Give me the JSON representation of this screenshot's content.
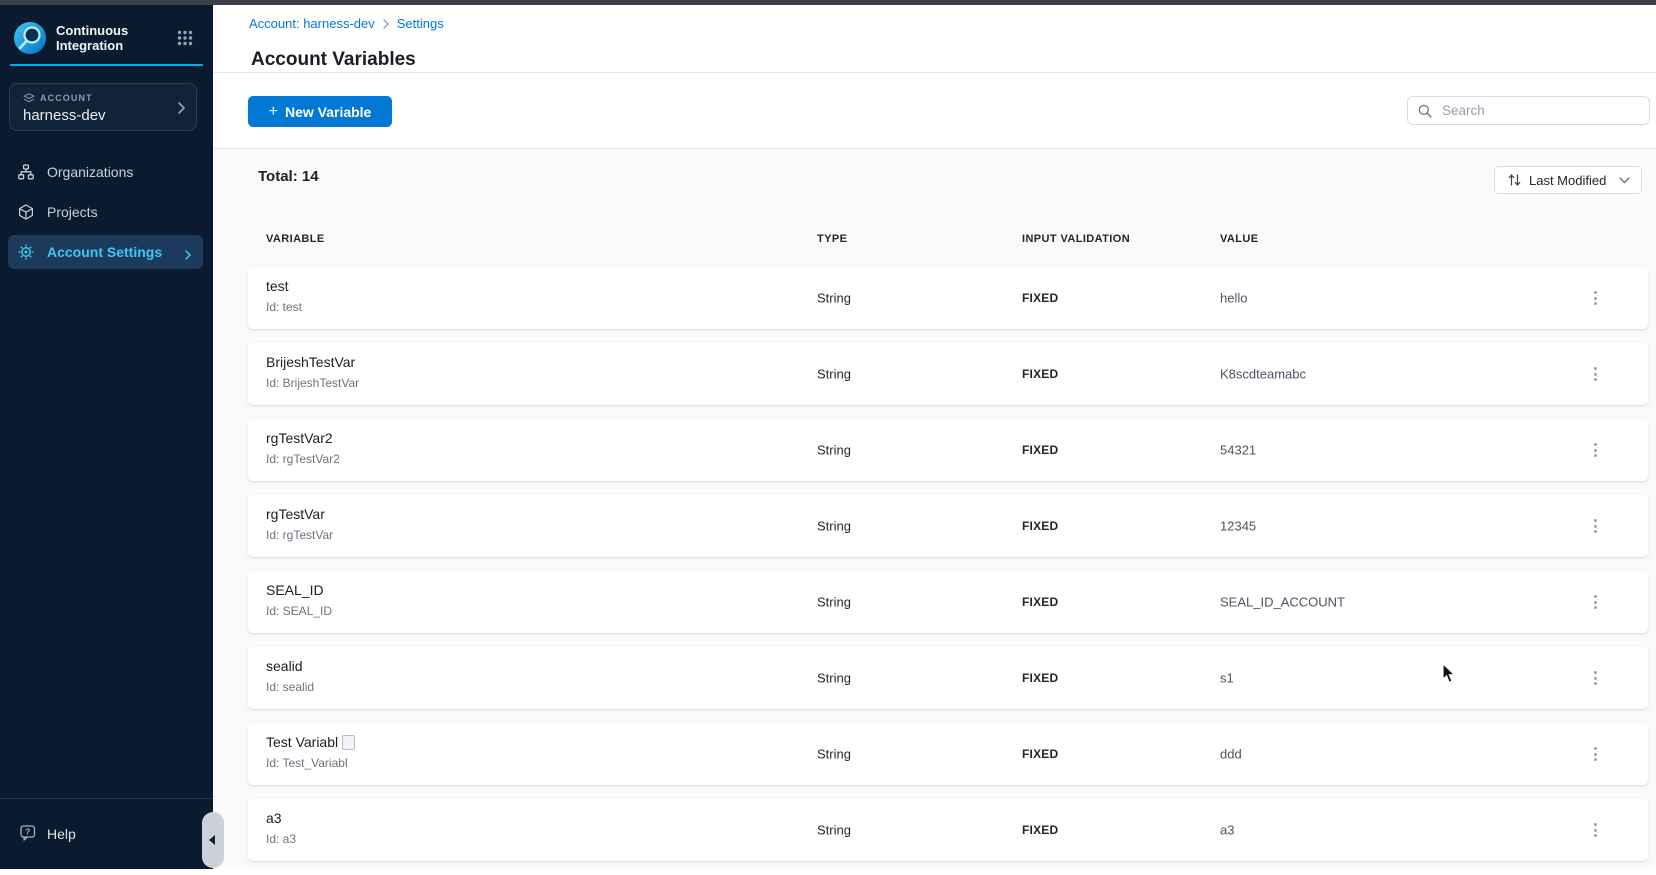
{
  "sidebar": {
    "module_line1": "Continuous",
    "module_line2": "Integration",
    "account": {
      "label": "ACCOUNT",
      "name": "harness-dev"
    },
    "nav": [
      {
        "label": "Organizations",
        "icon": "org-chart-icon",
        "selected": false
      },
      {
        "label": "Projects",
        "icon": "cube-icon",
        "selected": false
      },
      {
        "label": "Account Settings",
        "icon": "gear-icon",
        "selected": true
      }
    ],
    "help_label": "Help"
  },
  "breadcrumb": {
    "account_link": "Account: harness-dev",
    "separator": "›",
    "current": "Settings"
  },
  "page": {
    "title": "Account Variables"
  },
  "toolbar": {
    "new_variable_label": "New Variable",
    "plus_glyph": "+",
    "search_placeholder": "Search"
  },
  "list": {
    "total_label": "Total: 14",
    "sort_label": "Last Modified",
    "columns": {
      "variable": "VARIABLE",
      "type": "TYPE",
      "validation": "INPUT VALIDATION",
      "value": "VALUE"
    },
    "rows": [
      {
        "name": "test",
        "id": "Id: test",
        "type": "String",
        "validation": "FIXED",
        "value": "hello"
      },
      {
        "name": "BrijeshTestVar",
        "id": "Id: BrijeshTestVar",
        "type": "String",
        "validation": "FIXED",
        "value": "K8scdteamabc"
      },
      {
        "name": "rgTestVar2",
        "id": "Id: rgTestVar2",
        "type": "String",
        "validation": "FIXED",
        "value": "54321"
      },
      {
        "name": "rgTestVar",
        "id": "Id: rgTestVar",
        "type": "String",
        "validation": "FIXED",
        "value": "12345"
      },
      {
        "name": "SEAL_ID",
        "id": "Id: SEAL_ID",
        "type": "String",
        "validation": "FIXED",
        "value": "SEAL_ID_ACCOUNT"
      },
      {
        "name": "sealid",
        "id": "Id: sealid",
        "type": "String",
        "validation": "FIXED",
        "value": "s1"
      },
      {
        "name": "Test Variabl",
        "id": "Id: Test_Variabl",
        "type": "String",
        "validation": "FIXED",
        "value": "ddd",
        "name_has_box_glyph": true
      },
      {
        "name": "a3",
        "id": "Id: a3",
        "type": "String",
        "validation": "FIXED",
        "value": "a3"
      }
    ]
  },
  "colors": {
    "primary_blue": "#0278d5",
    "cyan_accent": "#3dc7f6",
    "cyan_line": "#00ade4",
    "sidebar_bg": "#0a1b30",
    "nav_selected_bg": "#1c3a5c",
    "content_bg": "#fafafa"
  }
}
